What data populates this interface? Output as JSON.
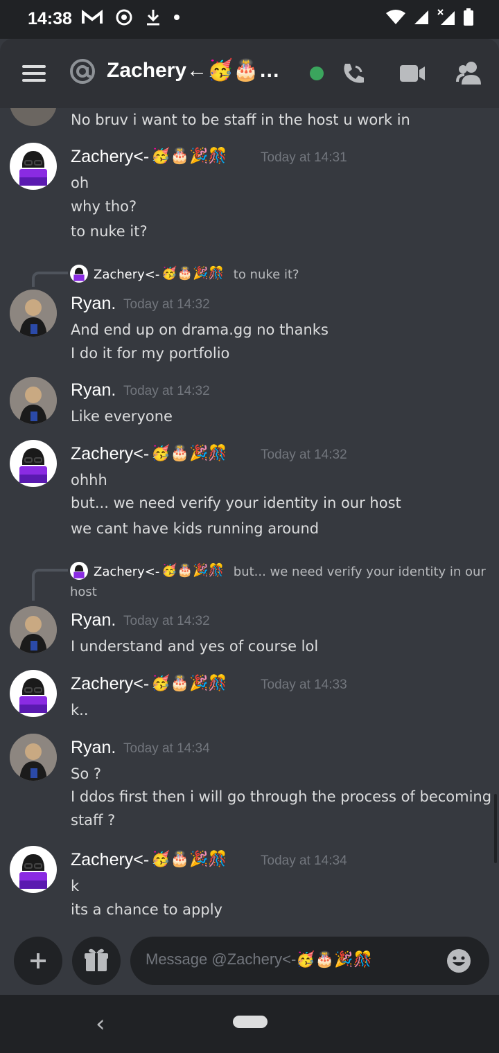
{
  "status_bar": {
    "time": "14:38"
  },
  "header": {
    "title": "Zachery←🥳🎂…",
    "icons": [
      "hamburger-icon",
      "at-icon",
      "online-status-dot",
      "phone-call-icon",
      "video-call-icon",
      "members-icon"
    ]
  },
  "messages": {
    "partial_line": "No bruv i want to be staff in the host u work in",
    "zachery_name": "Zachery<-",
    "zachery_emojis": "🥳🎂🎉🎊",
    "ryan_name": "Ryan.",
    "m1": {
      "time": "Today at 14:31",
      "lines": [
        "oh",
        "why tho?",
        "to nuke it?"
      ]
    },
    "reply1": {
      "name": "Zachery<-",
      "text": "to nuke it?"
    },
    "m2": {
      "time": "Today at 14:32",
      "lines": [
        "And end up on drama.gg no thanks",
        "I do it for my portfolio"
      ]
    },
    "m3": {
      "time": "Today at 14:32",
      "lines": [
        "Like everyone"
      ]
    },
    "m4": {
      "time": "Today at 14:32",
      "lines": [
        "ohhh",
        "but... we need verify your identity in our host",
        "we cant have kids running around"
      ]
    },
    "reply2": {
      "name": "Zachery<-",
      "text": "but... we need verify your identity in our",
      "text_cont": "host"
    },
    "m5": {
      "time": "Today at 14:32",
      "lines": [
        "I understand and yes of course lol"
      ]
    },
    "m6": {
      "time": "Today at 14:33",
      "lines": [
        "k.."
      ]
    },
    "m7": {
      "time": "Today at 14:34",
      "lines": [
        "So ?",
        "I ddos first then i will go through the process of becoming",
        "staff ?"
      ]
    },
    "m8": {
      "time": "Today at 14:34",
      "lines": [
        "k",
        "its a chance to apply"
      ]
    }
  },
  "input": {
    "placeholder": "Message @Zachery<-🥳🎂🎉🎊"
  },
  "nav": {
    "back": "‹"
  }
}
